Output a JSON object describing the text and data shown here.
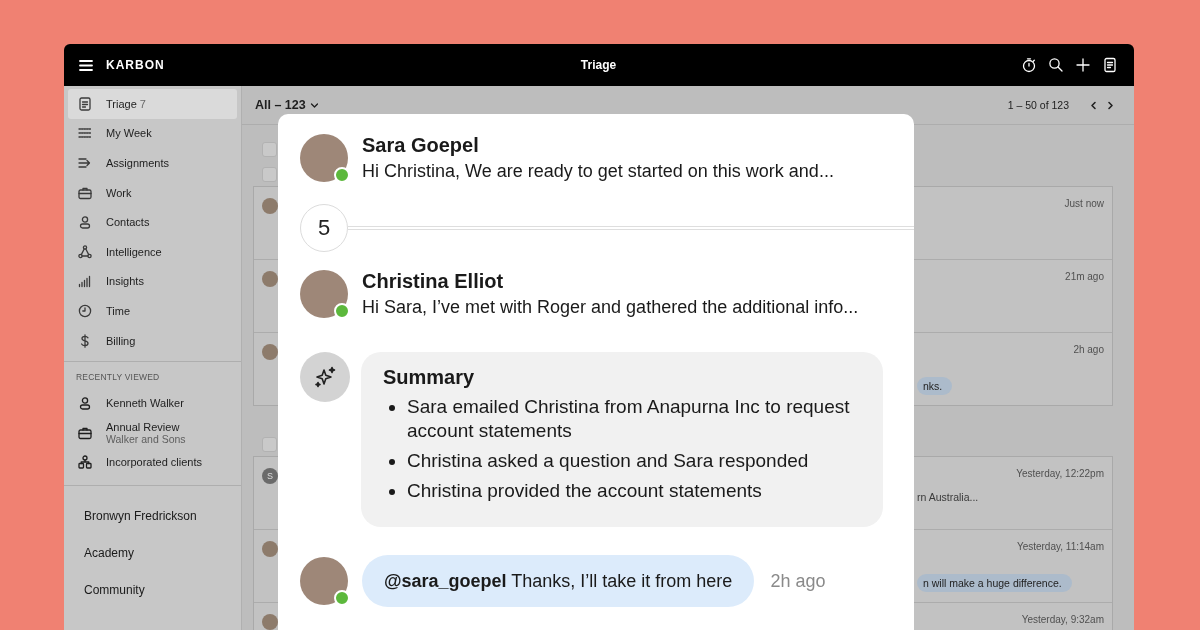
{
  "topbar": {
    "brand": "KARBON",
    "title": "Triage"
  },
  "sidebar": {
    "nav": [
      {
        "label": "Triage",
        "count": "7",
        "selected": true
      },
      {
        "label": "My Week",
        "selected": false
      },
      {
        "label": "Assignments",
        "selected": false
      },
      {
        "label": "Work",
        "selected": false
      },
      {
        "label": "Contacts",
        "selected": false
      },
      {
        "label": "Intelligence",
        "selected": false
      },
      {
        "label": "Insights",
        "selected": false
      },
      {
        "label": "Time",
        "selected": false
      },
      {
        "label": "Billing",
        "selected": false
      }
    ],
    "recent_heading": "RECENTLY VIEWED",
    "recent": [
      {
        "label": "Kenneth Walker"
      },
      {
        "label": "Annual Review",
        "sublabel": "Walker and Sons"
      },
      {
        "label": "Incorporated clients"
      }
    ],
    "links": [
      "Bronwyn Fredrickson",
      "Academy",
      "Community"
    ]
  },
  "list": {
    "filter": "All – 123",
    "range": "1 – 50 of 123",
    "groups": [
      {
        "checkboxes": [
          {
            "checked": false
          },
          {
            "checked": false
          }
        ],
        "rows": [
          {
            "kind": "photo",
            "time": "Just now"
          },
          {
            "kind": "photo",
            "time": "21m ago"
          },
          {
            "kind": "photo",
            "time": "2h ago",
            "chip": "nks."
          }
        ]
      },
      {
        "checkboxes": [
          {
            "checked": false
          }
        ],
        "rows": [
          {
            "kind": "letter",
            "initial": "S",
            "time": "Yesterday, 12:22pm",
            "snippet": "rn Australia..."
          },
          {
            "kind": "photo",
            "time": "Yesterday, 11:14am",
            "chip": "n will make a huge difference."
          },
          {
            "kind": "photo",
            "time": "Yesterday, 9:32am"
          }
        ]
      }
    ]
  },
  "thread": {
    "items": [
      {
        "kind": "message",
        "author": "Sara Goepel",
        "online": true,
        "text": "Hi Christina, We are ready to get started on this work and..."
      },
      {
        "kind": "collapsed",
        "count": "5"
      },
      {
        "kind": "message",
        "author": "Christina Elliot",
        "online": true,
        "text": "Hi Sara, I’ve met with Roger and gathered the additional info..."
      },
      {
        "kind": "summary",
        "title": "Summary",
        "bullets": [
          "Sara emailed Christina from Anapurna Inc to request account statements",
          "Christina asked a question and Sara responded",
          "Christina provided the account statements"
        ]
      },
      {
        "kind": "reply",
        "online": true,
        "text": "**@sara_goepel** Thanks, I’ll take it from here",
        "time": "2h ago"
      }
    ]
  }
}
